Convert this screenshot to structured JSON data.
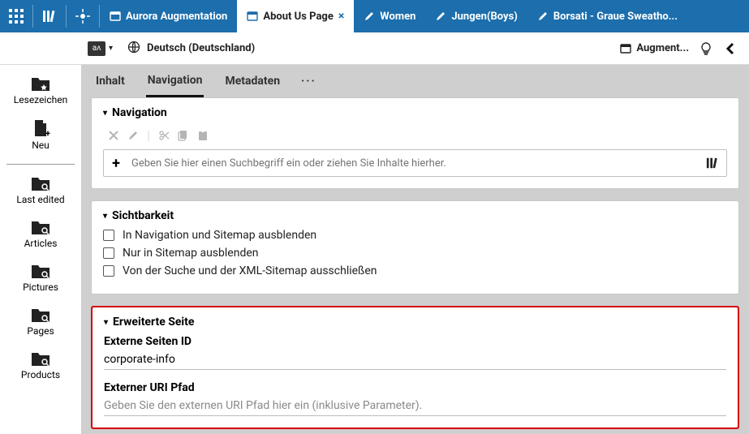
{
  "topbar": {
    "tabs": [
      {
        "label": "Aurora Augmentation",
        "active": false,
        "closable": false,
        "icon": "site"
      },
      {
        "label": "About Us Page",
        "active": true,
        "closable": true,
        "icon": "site"
      },
      {
        "label": "Women",
        "active": false,
        "closable": false,
        "icon": "pencil"
      },
      {
        "label": "Jungen(Boys)",
        "active": false,
        "closable": false,
        "icon": "pencil"
      },
      {
        "label": "Borsati - Graue Sweatho...",
        "active": false,
        "closable": false,
        "icon": "pencil"
      }
    ]
  },
  "subbar": {
    "locale_label": "Deutsch (Deutschland)",
    "augment_label": "Augment..."
  },
  "sidebar": {
    "items": [
      {
        "label": "Lesezeichen",
        "icon": "folder-star"
      },
      {
        "label": "Neu",
        "icon": "doc-plus",
        "divider_after": true
      },
      {
        "label": "Last edited",
        "icon": "folder-search"
      },
      {
        "label": "Articles",
        "icon": "folder-search"
      },
      {
        "label": "Pictures",
        "icon": "folder-search"
      },
      {
        "label": "Pages",
        "icon": "folder-search"
      },
      {
        "label": "Products",
        "icon": "folder-search"
      }
    ]
  },
  "editor_tabs": {
    "items": [
      {
        "label": "Inhalt",
        "active": false
      },
      {
        "label": "Navigation",
        "active": true
      },
      {
        "label": "Metadaten",
        "active": false
      }
    ]
  },
  "panels": {
    "navigation": {
      "title": "Navigation",
      "search_placeholder": "Geben Sie hier einen Suchbegriff ein oder ziehen Sie Inhalte hierher."
    },
    "visibility": {
      "title": "Sichtbarkeit",
      "options": [
        "In Navigation und Sitemap ausblenden",
        "Nur in Sitemap ausblenden",
        "Von der Suche und der XML-Sitemap ausschließen"
      ]
    },
    "extended": {
      "title": "Erweiterte Seite",
      "field_ext_id_label": "Externe Seiten ID",
      "field_ext_id_value": "corporate-info",
      "field_uri_label": "Externer URI Pfad",
      "field_uri_placeholder": "Geben Sie den externen URI Pfad hier ein (inklusive Parameter)."
    }
  }
}
